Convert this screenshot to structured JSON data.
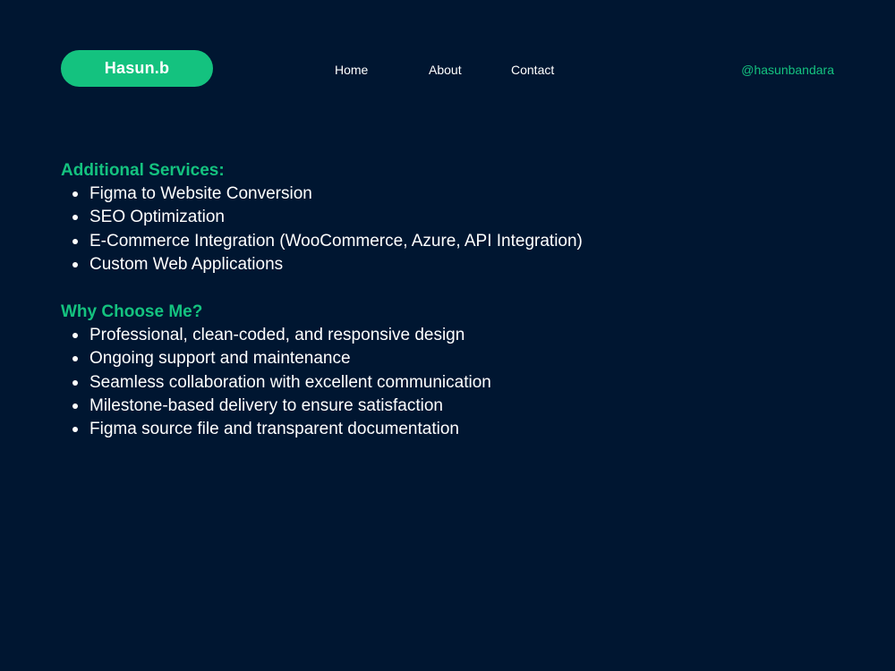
{
  "header": {
    "logo": "Hasun.b",
    "nav": [
      {
        "label": "Home"
      },
      {
        "label": "About"
      },
      {
        "label": "Contact"
      }
    ],
    "handle": "@hasunbandara"
  },
  "sections": [
    {
      "title": "Additional Services:",
      "items": [
        "Figma to Website Conversion",
        "SEO Optimization",
        "E-Commerce Integration (WooCommerce, Azure, API Integration)",
        "Custom Web Applications"
      ]
    },
    {
      "title": "Why Choose Me?",
      "items": [
        "Professional, clean-coded, and responsive design",
        "Ongoing support and maintenance",
        "Seamless collaboration with excellent communication",
        "Milestone-based delivery to ensure satisfaction",
        "Figma source file and transparent documentation"
      ]
    }
  ],
  "colors": {
    "background": "#001631",
    "accent": "#14c27f",
    "text": "#ffffff"
  }
}
